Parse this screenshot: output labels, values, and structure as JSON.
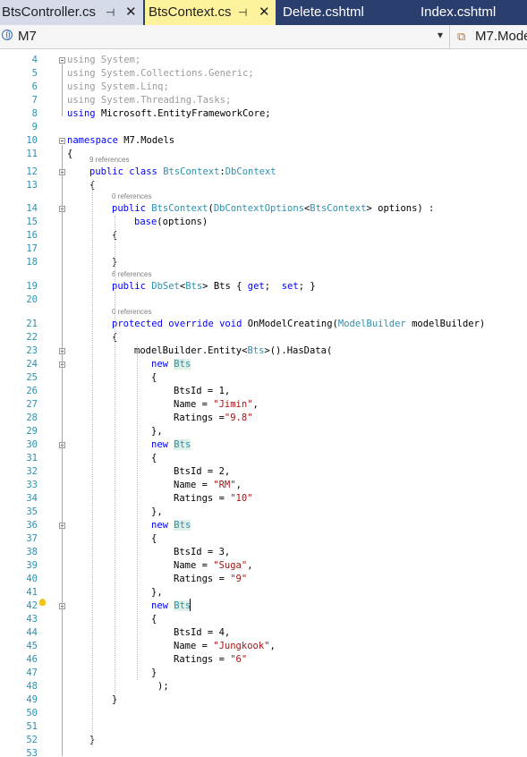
{
  "tabs": [
    {
      "label": "BtsController.cs",
      "pin": "⊣",
      "close": "✕",
      "active": false
    },
    {
      "label": "BtsContext.cs",
      "pin": "⊣",
      "close": "✕",
      "active": true
    },
    {
      "label": "Delete.cshtml",
      "active": false
    },
    {
      "label": "Index.cshtml",
      "active": false
    }
  ],
  "nav": {
    "project": "M7",
    "dropdown": "▾",
    "class": "M7.Mode"
  },
  "colors": {
    "keyword": "#0000ff",
    "type": "#2b91af",
    "string": "#a31515",
    "tab_active_bg": "#fff29d",
    "tab_bar_bg": "#2b3f6e"
  },
  "lines": [
    {
      "n": "4",
      "t": [
        [
          "gr",
          "using System;"
        ]
      ]
    },
    {
      "n": "5",
      "t": [
        [
          "gr",
          "using System.Collections.Generic;"
        ]
      ]
    },
    {
      "n": "6",
      "t": [
        [
          "gr",
          "using System.Linq;"
        ]
      ]
    },
    {
      "n": "7",
      "t": [
        [
          "gr",
          "using System.Threading.Tasks;"
        ]
      ]
    },
    {
      "n": "8",
      "t": [
        [
          "kw",
          "using"
        ],
        [
          "",
          "Microsoft.EntityFrameworkCore;"
        ]
      ]
    },
    {
      "n": "9",
      "t": []
    },
    {
      "n": "10",
      "t": [
        [
          "kw",
          "namespace"
        ],
        [
          "",
          "M7.Models"
        ]
      ]
    },
    {
      "n": "11",
      "t": [
        [
          "",
          "{"
        ]
      ]
    },
    {
      "n": "12",
      "lens": "9 references",
      "t": [
        [
          "kw",
          "public class"
        ],
        [
          "ty",
          "BtsContext"
        ],
        [
          "",
          ":"
        ],
        [
          "ty",
          "DbContext"
        ]
      ]
    },
    {
      "n": "13",
      "t": [
        [
          "",
          "{"
        ]
      ]
    },
    {
      "n": "14",
      "lens": "0 references",
      "t": [
        [
          "kw",
          "public"
        ],
        [
          "ty",
          "BtsContext"
        ],
        [
          "",
          "("
        ],
        [
          "ty",
          "DbContextOptions"
        ],
        [
          "",
          "<"
        ],
        [
          "ty",
          "BtsContext"
        ],
        [
          "",
          "> options) :"
        ]
      ]
    },
    {
      "n": "15",
      "t": [
        [
          "kw",
          "base"
        ],
        [
          "",
          "(options)"
        ]
      ]
    },
    {
      "n": "16",
      "t": [
        [
          "",
          "{"
        ]
      ]
    },
    {
      "n": "17",
      "t": []
    },
    {
      "n": "18",
      "t": [
        [
          "",
          "}"
        ]
      ]
    },
    {
      "n": "19",
      "lens": "6 references",
      "t": [
        [
          "kw",
          "public"
        ],
        [
          "ty",
          "DbSet"
        ],
        [
          "",
          "<"
        ],
        [
          "ty",
          "Bts"
        ],
        [
          "",
          "> Bts {"
        ],
        [
          "kw",
          "get"
        ],
        [
          "",
          "; "
        ],
        [
          "kw",
          "set"
        ],
        [
          "",
          "; }"
        ]
      ]
    },
    {
      "n": "20",
      "t": []
    },
    {
      "n": "21",
      "lens": "0 references",
      "t": [
        [
          "kw",
          "protected override void"
        ],
        [
          "",
          "OnModelCreating("
        ],
        [
          "ty",
          "ModelBuilder"
        ],
        [
          "",
          "modelBuilder)"
        ]
      ]
    },
    {
      "n": "22",
      "t": [
        [
          "",
          "{"
        ]
      ]
    },
    {
      "n": "23",
      "t": [
        [
          "",
          "modelBuilder.Entity<"
        ],
        [
          "ty",
          "Bts"
        ],
        [
          "",
          ">().HasData("
        ]
      ]
    },
    {
      "n": "24",
      "t": [
        [
          "kw",
          "new"
        ],
        [
          "ty",
          "Bts"
        ]
      ]
    },
    {
      "n": "25",
      "t": [
        [
          "",
          "{"
        ]
      ]
    },
    {
      "n": "26",
      "t": [
        [
          "",
          "BtsId = 1,"
        ]
      ]
    },
    {
      "n": "27",
      "t": [
        [
          "",
          "Name = "
        ],
        [
          "st",
          "\"Jimin\""
        ],
        [
          "",
          ","
        ]
      ]
    },
    {
      "n": "28",
      "t": [
        [
          "",
          "Ratings ="
        ],
        [
          "st",
          "\"9.8\""
        ]
      ]
    },
    {
      "n": "29",
      "t": [
        [
          "",
          "},"
        ]
      ]
    },
    {
      "n": "30",
      "t": [
        [
          "kw",
          "new"
        ],
        [
          "ty",
          "Bts"
        ]
      ]
    },
    {
      "n": "31",
      "t": [
        [
          "",
          "{"
        ]
      ]
    },
    {
      "n": "32",
      "t": [
        [
          "",
          "BtsId = 2,"
        ]
      ]
    },
    {
      "n": "33",
      "t": [
        [
          "",
          "Name = "
        ],
        [
          "st",
          "\"RM\""
        ],
        [
          "",
          ","
        ]
      ]
    },
    {
      "n": "34",
      "t": [
        [
          "",
          "Ratings = "
        ],
        [
          "st",
          "\"10\""
        ]
      ]
    },
    {
      "n": "35",
      "t": [
        [
          "",
          "},"
        ]
      ]
    },
    {
      "n": "36",
      "t": [
        [
          "kw",
          "new"
        ],
        [
          "ty",
          "Bts"
        ]
      ]
    },
    {
      "n": "37",
      "t": [
        [
          "",
          "{"
        ]
      ]
    },
    {
      "n": "38",
      "t": [
        [
          "",
          "BtsId = 3,"
        ]
      ]
    },
    {
      "n": "39",
      "t": [
        [
          "",
          "Name = "
        ],
        [
          "st",
          "\"Suga\""
        ],
        [
          "",
          ","
        ]
      ]
    },
    {
      "n": "40",
      "t": [
        [
          "",
          "Ratings = "
        ],
        [
          "st",
          "\"9\""
        ]
      ]
    },
    {
      "n": "41",
      "t": [
        [
          "",
          "},"
        ]
      ]
    },
    {
      "n": "42",
      "t": [
        [
          "kw",
          "new"
        ],
        [
          "ty",
          "Bts"
        ]
      ]
    },
    {
      "n": "43",
      "t": [
        [
          "",
          "{"
        ]
      ]
    },
    {
      "n": "44",
      "t": [
        [
          "",
          "BtsId = 4,"
        ]
      ]
    },
    {
      "n": "45",
      "t": [
        [
          "",
          "Name = "
        ],
        [
          "st",
          "\"Jungkook\""
        ],
        [
          "",
          ","
        ]
      ]
    },
    {
      "n": "46",
      "t": [
        [
          "",
          "Ratings = "
        ],
        [
          "st",
          "\"6\""
        ]
      ]
    },
    {
      "n": "47",
      "t": [
        [
          "",
          "}"
        ]
      ]
    },
    {
      "n": "48",
      "t": [
        [
          "",
          ");"
        ]
      ]
    },
    {
      "n": "49",
      "t": [
        [
          "",
          "}"
        ]
      ]
    },
    {
      "n": "50",
      "t": []
    },
    {
      "n": "51",
      "t": []
    },
    {
      "n": "52",
      "t": [
        [
          "",
          "}"
        ]
      ]
    },
    {
      "n": "53",
      "t": []
    }
  ]
}
